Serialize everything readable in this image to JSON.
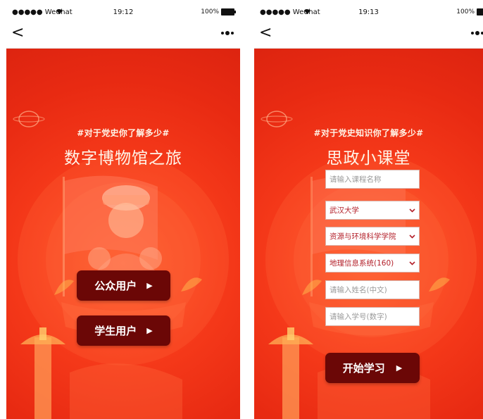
{
  "status_left": {
    "carrier": "●●●●● WeChat",
    "wifi_icon": "wifi-icon",
    "time": "19:12",
    "battery": "100%"
  },
  "status_right": {
    "carrier": "●●●●● WeChat",
    "wifi_icon": "wifi-icon",
    "time": "19:13",
    "battery": "100%"
  },
  "nav": {
    "back_glyph": "<",
    "more_icon": "more-dots-icon"
  },
  "screen1": {
    "hashtag": "#对于党史你了解多少#",
    "title": "数字博物馆之旅",
    "buttons": [
      {
        "label": "公众用户",
        "arrow": "▶"
      },
      {
        "label": "学生用户",
        "arrow": "▶"
      }
    ]
  },
  "screen2": {
    "hashtag": "#对于党史知识你了解多少#",
    "title": "思政小课堂",
    "course_placeholder": "请输入课程名称",
    "university": "武汉大学",
    "school": "资源与环境科学学院",
    "major": "地理信息系统(160)",
    "name_placeholder": "请输入姓名(中文)",
    "id_placeholder": "请输入学号(数字)",
    "start_label": "开始学习",
    "start_arrow": "▶"
  },
  "colors": {
    "background_red": "#f63a1a",
    "button_dark": "#6b0706",
    "select_text": "#b3202a"
  }
}
